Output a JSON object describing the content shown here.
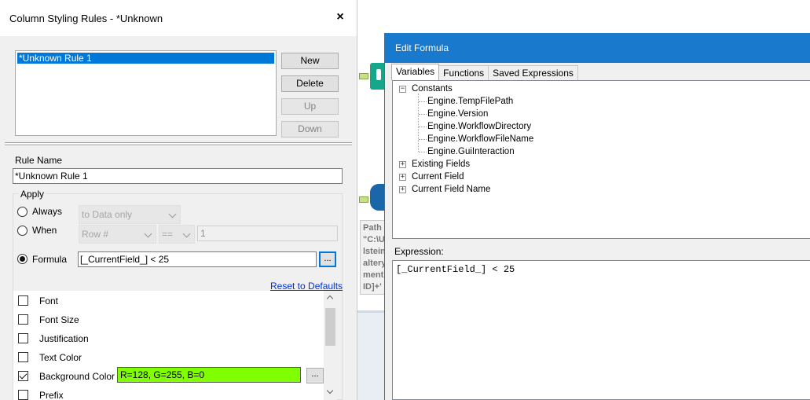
{
  "background": {
    "annotation_lines": [
      "Path",
      "\"C:\\U",
      "lstein",
      "altery",
      "ment",
      "ID]+'"
    ]
  },
  "column_styling_dialog": {
    "title": "Column Styling Rules - *Unknown",
    "close_glyph": "×",
    "rules": [
      "*Unknown Rule 1"
    ],
    "buttons": {
      "new": "New",
      "delete": "Delete",
      "up": "Up",
      "down": "Down"
    },
    "rule_name_label": "Rule Name",
    "rule_name_value": "*Unknown Rule 1",
    "apply": {
      "label": "Apply",
      "always_label": "Always",
      "when_label": "When",
      "formula_label": "Formula",
      "always_scope": "to Data only",
      "when_field": "Row #",
      "when_operator": "==",
      "when_value": "1",
      "formula_value": "[_CurrentField_] < 25",
      "formula_button": "...",
      "selected": "Formula"
    },
    "reset_link": "Reset to Defaults",
    "options": [
      {
        "label": "Font",
        "checked": false
      },
      {
        "label": "Font Size",
        "checked": false
      },
      {
        "label": "Justification",
        "checked": false
      },
      {
        "label": "Text Color",
        "checked": false
      },
      {
        "label": "Background Color",
        "checked": true,
        "value": "R=128, G=255, B=0",
        "color": "#80ff00",
        "button": "..."
      },
      {
        "label": "Prefix",
        "checked": false
      }
    ]
  },
  "edit_formula": {
    "title": "Edit Formula",
    "tabs": [
      "Variables",
      "Functions",
      "Saved Expressions"
    ],
    "active_tab": "Variables",
    "tree": {
      "constants_label": "Constants",
      "constants": [
        "Engine.TempFilePath",
        "Engine.Version",
        "Engine.WorkflowDirectory",
        "Engine.WorkflowFileName",
        "Engine.GuiInteraction"
      ],
      "groups": [
        "Existing Fields",
        "Current Field",
        "Current Field Name"
      ]
    },
    "expression_label": "Expression:",
    "expression": "[_CurrentField_] < 25"
  }
}
